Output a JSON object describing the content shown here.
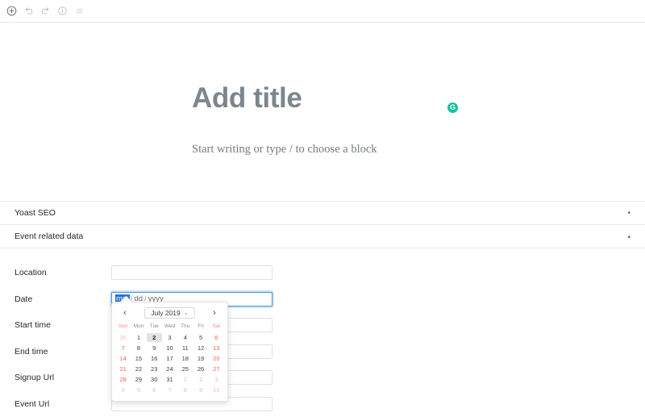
{
  "toolbar": {
    "items": [
      {
        "name": "add-block-button",
        "label": "Add block"
      },
      {
        "name": "undo-button",
        "label": "Undo"
      },
      {
        "name": "redo-button",
        "label": "Redo"
      },
      {
        "name": "details-button",
        "label": "Details"
      },
      {
        "name": "list-view-button",
        "label": "List view"
      }
    ]
  },
  "editor": {
    "title_placeholder": "Add title",
    "body_placeholder": "Start writing or type / to choose a block",
    "grammarly_label": "G"
  },
  "panels": [
    {
      "title": "Yoast SEO",
      "caret": "▾",
      "expanded": false
    },
    {
      "title": "Event related data",
      "caret": "▴",
      "expanded": true
    }
  ],
  "form": {
    "fields": [
      {
        "label": "Location",
        "value": "",
        "type": "text",
        "focused": false
      },
      {
        "label": "Date",
        "value": "",
        "type": "date",
        "focused": true
      },
      {
        "label": "Start time",
        "value": "",
        "type": "text",
        "focused": false
      },
      {
        "label": "End time",
        "value": "",
        "type": "text",
        "focused": false
      },
      {
        "label": "Signup Url",
        "value": "",
        "type": "text",
        "focused": false
      },
      {
        "label": "Event Url",
        "value": "",
        "type": "text",
        "focused": false
      }
    ],
    "date_segments": {
      "month": "mm",
      "day": "dd",
      "year": "yyyy",
      "separator": "/"
    }
  },
  "datepicker": {
    "prev_label": "‹",
    "next_label": "›",
    "month_year": "July 2019",
    "month_chevron": "⌄",
    "weekdays": [
      "Sun",
      "Mon",
      "Tue",
      "Wed",
      "Thu",
      "Fri",
      "Sat"
    ],
    "selected_day": "2",
    "weeks": [
      [
        {
          "d": "30",
          "muted": true,
          "weekend": true
        },
        {
          "d": "1",
          "muted": false,
          "weekend": false
        },
        {
          "d": "2",
          "muted": false,
          "weekend": false,
          "selected": true
        },
        {
          "d": "3",
          "muted": false,
          "weekend": false
        },
        {
          "d": "4",
          "muted": false,
          "weekend": false
        },
        {
          "d": "5",
          "muted": false,
          "weekend": false
        },
        {
          "d": "6",
          "muted": false,
          "weekend": true
        }
      ],
      [
        {
          "d": "7",
          "muted": false,
          "weekend": true
        },
        {
          "d": "8",
          "muted": false,
          "weekend": false
        },
        {
          "d": "9",
          "muted": false,
          "weekend": false
        },
        {
          "d": "10",
          "muted": false,
          "weekend": false
        },
        {
          "d": "11",
          "muted": false,
          "weekend": false
        },
        {
          "d": "12",
          "muted": false,
          "weekend": false
        },
        {
          "d": "13",
          "muted": false,
          "weekend": true
        }
      ],
      [
        {
          "d": "14",
          "muted": false,
          "weekend": true
        },
        {
          "d": "15",
          "muted": false,
          "weekend": false
        },
        {
          "d": "16",
          "muted": false,
          "weekend": false
        },
        {
          "d": "17",
          "muted": false,
          "weekend": false
        },
        {
          "d": "18",
          "muted": false,
          "weekend": false
        },
        {
          "d": "19",
          "muted": false,
          "weekend": false
        },
        {
          "d": "20",
          "muted": false,
          "weekend": true
        }
      ],
      [
        {
          "d": "21",
          "muted": false,
          "weekend": true
        },
        {
          "d": "22",
          "muted": false,
          "weekend": false
        },
        {
          "d": "23",
          "muted": false,
          "weekend": false
        },
        {
          "d": "24",
          "muted": false,
          "weekend": false
        },
        {
          "d": "25",
          "muted": false,
          "weekend": false
        },
        {
          "d": "26",
          "muted": false,
          "weekend": false
        },
        {
          "d": "27",
          "muted": false,
          "weekend": true
        }
      ],
      [
        {
          "d": "28",
          "muted": false,
          "weekend": true
        },
        {
          "d": "29",
          "muted": false,
          "weekend": false
        },
        {
          "d": "30",
          "muted": false,
          "weekend": false
        },
        {
          "d": "31",
          "muted": false,
          "weekend": false
        },
        {
          "d": "1",
          "muted": true,
          "weekend": false
        },
        {
          "d": "2",
          "muted": true,
          "weekend": false
        },
        {
          "d": "3",
          "muted": true,
          "weekend": true
        }
      ],
      [
        {
          "d": "4",
          "muted": true,
          "weekend": true
        },
        {
          "d": "5",
          "muted": true,
          "weekend": false
        },
        {
          "d": "6",
          "muted": true,
          "weekend": false
        },
        {
          "d": "7",
          "muted": true,
          "weekend": false
        },
        {
          "d": "8",
          "muted": true,
          "weekend": false
        },
        {
          "d": "9",
          "muted": true,
          "weekend": false
        },
        {
          "d": "10",
          "muted": true,
          "weekend": true
        }
      ]
    ]
  },
  "colors": {
    "accent_focus": "#4a90d9",
    "selection_blue": "#2a6fd6",
    "weekend_red": "#f0625c",
    "grammarly_green": "#15c39a",
    "border": "#e8eaec"
  }
}
